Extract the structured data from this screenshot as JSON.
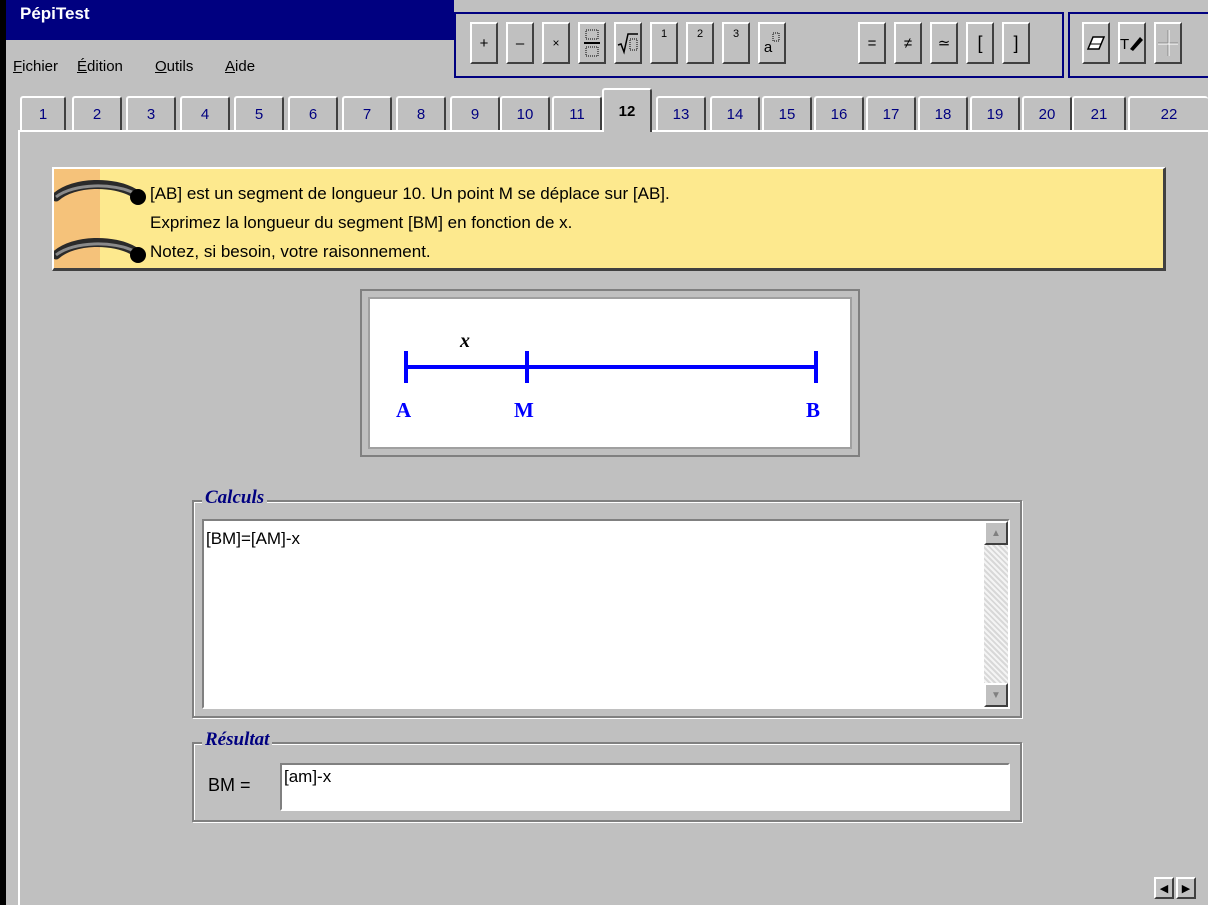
{
  "app": {
    "title": "PépiTest"
  },
  "menu": {
    "items": [
      {
        "label": "Fichier",
        "accel": "F",
        "rest": "ichier"
      },
      {
        "label": "Édition",
        "accel": "É",
        "rest": "dition"
      },
      {
        "label": "Outils",
        "accel": "O",
        "rest": "utils"
      },
      {
        "label": "Aide",
        "accel": "A",
        "rest": "ide"
      }
    ]
  },
  "toolbar": {
    "math_buttons": [
      "+",
      "–",
      "×",
      "fraction",
      "√",
      "1",
      "2",
      "3",
      "a",
      "=",
      "≠",
      "≃",
      "[",
      "]"
    ],
    "tool_buttons": [
      "eraser-icon",
      "text-pen-icon",
      "crosshair-icon"
    ]
  },
  "tabs": {
    "items": [
      "1",
      "2",
      "3",
      "4",
      "5",
      "6",
      "7",
      "8",
      "9",
      "10",
      "11",
      "12",
      "13",
      "14",
      "15",
      "16",
      "17",
      "18",
      "19",
      "20",
      "21",
      "22"
    ],
    "active": "12"
  },
  "question": {
    "lines": [
      "[AB] est un segment de longueur 10. Un point M se déplace sur [AB].",
      "Exprimez la longueur du segment [BM] en fonction de x.",
      "Notez, si besoin, votre raisonnement."
    ]
  },
  "figure": {
    "segment_label": "x",
    "points": [
      "A",
      "M",
      "B"
    ],
    "color": "#0000ff"
  },
  "calculs": {
    "legend": "Calculs",
    "value": "[BM]=[AM]-x"
  },
  "resultat": {
    "legend": "Résultat",
    "label": "BM =",
    "value": "[am]-x"
  },
  "colors": {
    "titlebar": "#000080",
    "face": "#c0c0c0",
    "banner": "#fde98e",
    "tab_text": "#000080"
  }
}
